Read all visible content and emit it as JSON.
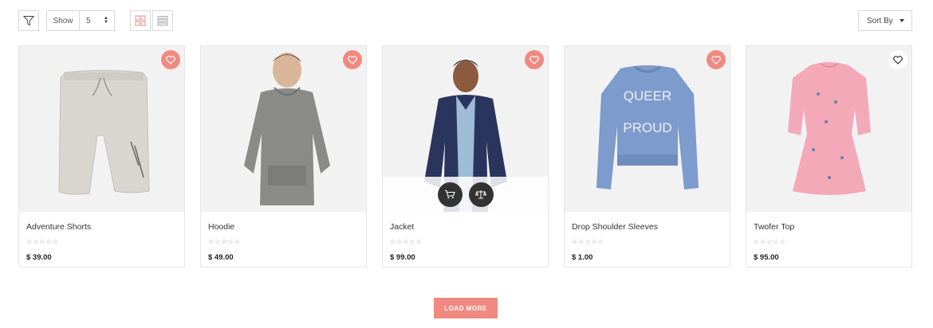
{
  "toolbar": {
    "filter_icon": "filter-icon",
    "show_label": "Show",
    "show_value": "5",
    "grid_icon": "grid-view-icon",
    "list_icon": "list-view-icon",
    "sort_label": "Sort By"
  },
  "colors": {
    "accent": "#f08a80",
    "card_bg": "#f2f2f3",
    "action": "#333333"
  },
  "products": [
    {
      "name": "Adventure Shorts",
      "price": "$ 39.00",
      "rating": "☆☆☆☆☆",
      "wishlisted": true
    },
    {
      "name": "Hoodie",
      "price": "$ 49.00",
      "rating": "☆☆☆☆☆",
      "wishlisted": true
    },
    {
      "name": "Jacket",
      "price": "$ 99.00",
      "rating": "☆☆☆☆☆",
      "wishlisted": true
    },
    {
      "name": "Drop Shoulder Sleeves",
      "price": "$ 1.00",
      "rating": "☆☆☆☆☆",
      "wishlisted": true
    },
    {
      "name": "Twofer Top",
      "price": "$ 95.00",
      "rating": "☆☆☆☆☆",
      "wishlisted": false
    }
  ],
  "sweater_print": {
    "line1": "QUEER",
    "line2": "PROUD"
  },
  "load_more_label": "LOAD MORE"
}
